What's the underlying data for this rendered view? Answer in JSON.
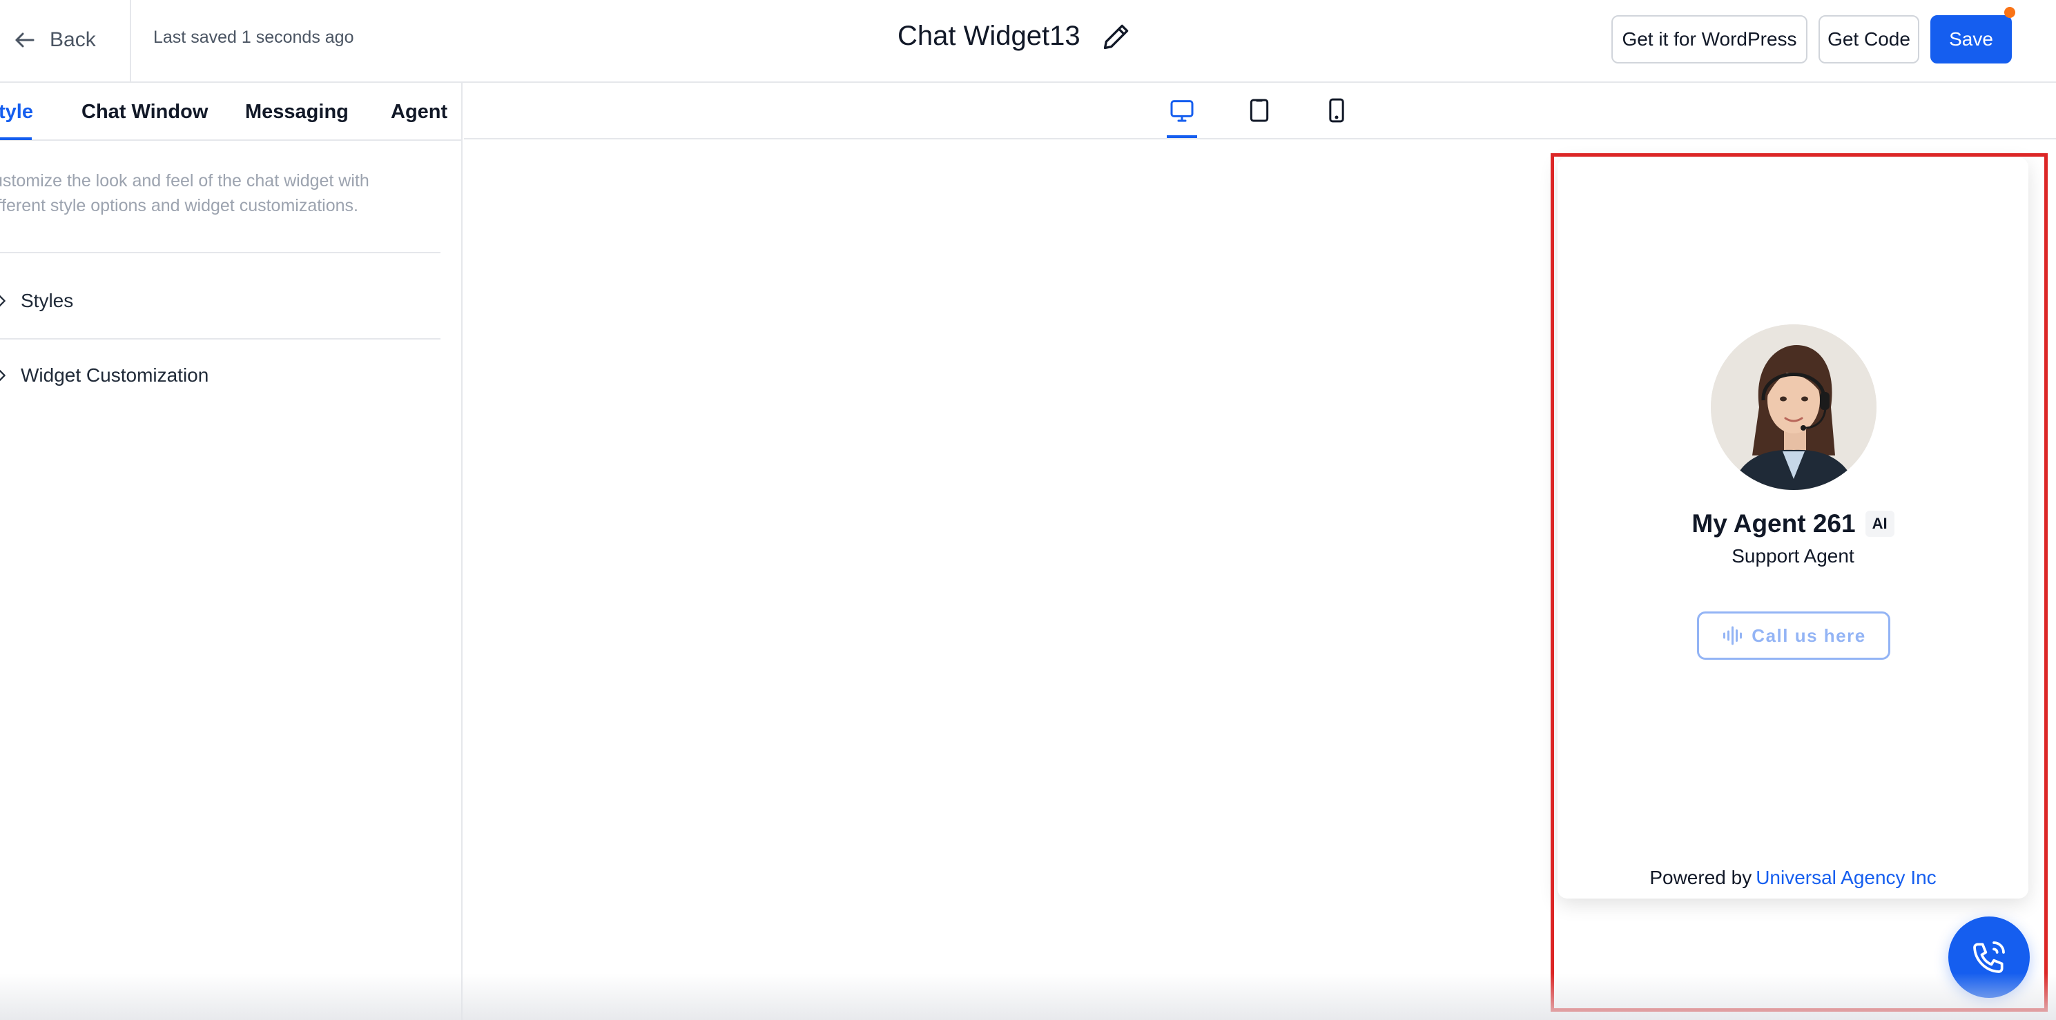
{
  "header": {
    "back_label": "Back",
    "last_saved": "Last saved 1 seconds ago",
    "title": "Chat Widget13",
    "wordpress_label": "Get it for WordPress",
    "get_code_label": "Get Code",
    "save_label": "Save"
  },
  "left_panel": {
    "tabs": [
      {
        "label": "tyle",
        "active": true
      },
      {
        "label": "Chat Window"
      },
      {
        "label": "Messaging"
      },
      {
        "label": "Agent"
      }
    ],
    "description": "ustomize the look and feel of the chat widget with ifferent style options and widget customizations.",
    "description_line1": "ustomize the look and feel of the chat widget with",
    "description_line2": "ifferent style options and widget customizations.",
    "sections": [
      {
        "label": "Styles",
        "icon": "chevron-right-icon"
      },
      {
        "label": "Widget Customization",
        "icon": "chevron-right-icon"
      }
    ]
  },
  "preview": {
    "device_toggles": [
      {
        "name": "desktop",
        "icon": "monitor-icon",
        "active": true
      },
      {
        "name": "tablet",
        "icon": "tablet-icon"
      },
      {
        "name": "mobile",
        "icon": "mobile-icon"
      }
    ]
  },
  "widget": {
    "agent_name": "My Agent 261",
    "ai_badge": "AI",
    "agent_role": "Support Agent",
    "call_label": "Call us here",
    "powered_by": "Powered by",
    "powered_link": "Universal Agency Inc"
  },
  "colors": {
    "accent": "#155eef",
    "highlight": "#dc2626",
    "notification_dot": "#f97316",
    "call_button_outline": "#93b4f5"
  }
}
